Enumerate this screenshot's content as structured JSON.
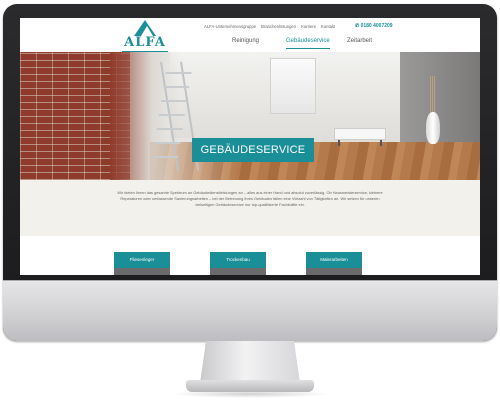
{
  "brand": {
    "name": "ALFA",
    "accent": "#1b8f98"
  },
  "topnav": {
    "items": [
      {
        "label": "ALFA-Unternehmensgruppe"
      },
      {
        "label": "Branchenlösungen"
      },
      {
        "label": "Karriere"
      },
      {
        "label": "Kontakt"
      }
    ],
    "phone": "0180 4007209"
  },
  "mainnav": {
    "items": [
      {
        "label": "Reinigung",
        "active": false
      },
      {
        "label": "Gebäudeservice",
        "active": true
      },
      {
        "label": "Zeitarbeit",
        "active": false
      }
    ]
  },
  "hero": {
    "title": "GEBÄUDESERVICE"
  },
  "intro": {
    "text": "Wir bieten Ihnen das gesamte Spektrum an Gebäudedienstleistungen an – alles aus einer Hand und absolut zuverlässig. Ob Hausmeisterservice, kleinere Reparaturen oder umfassende Sanierungsarbeiten – bei der Betreuung Ihres Gebäudes fallen eine Vielzahl von Tätigkeiten an. Wir setzen für unseren vielseitigen Gebäudeservice nur top-qualifizierte Fachkräfte ein."
  },
  "cards": [
    {
      "label": "Fliesenleger"
    },
    {
      "label": "Trockenbau"
    },
    {
      "label": "Malerarbeiten"
    }
  ]
}
